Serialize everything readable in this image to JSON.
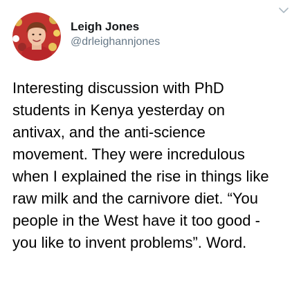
{
  "tweet": {
    "author": {
      "display_name": "Leigh Jones",
      "handle": "@drleighannjones",
      "avatar_icon": "profile-photo"
    },
    "menu_icon": "chevron-down-icon",
    "text": "Interesting discussion with PhD\nstudents in Kenya yesterday on\nantivax, and the anti-science\nmovement. They were incredulous\nwhen I explained the rise in things like\nraw milk and the carnivore diet. “You\npeople in the West have it too good -\nyou like to invent problems”. Word."
  },
  "colors": {
    "handle": "#657786",
    "text": "#000000",
    "chevron": "#aab8c2"
  }
}
